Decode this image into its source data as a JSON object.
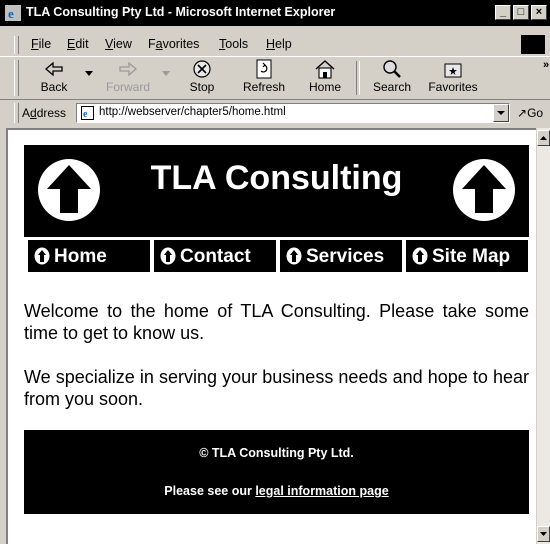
{
  "window": {
    "title": "TLA Consulting Pty Ltd - Microsoft Internet Explorer"
  },
  "menu": [
    "File",
    "Edit",
    "View",
    "Favorites",
    "Tools",
    "Help"
  ],
  "menu_mnemonics": [
    "F",
    "E",
    "V",
    "a",
    "T",
    "H"
  ],
  "toolbar": {
    "back": "Back",
    "forward": "Forward",
    "stop": "Stop",
    "refresh": "Refresh",
    "home": "Home",
    "search": "Search",
    "favorites": "Favorites"
  },
  "address": {
    "label": "Address",
    "url": "http://webserver/chapter5/home.html",
    "go": "Go"
  },
  "page": {
    "brand": "TLA Consulting",
    "nav": [
      "Home",
      "Contact",
      "Services",
      "Site Map"
    ],
    "para1": "Welcome to the home of TLA Consulting. Please take some time to get to know us.",
    "para2": "We specialize in serving your business needs and hope to hear from you soon.",
    "footer": {
      "copyright": "© TLA Consulting Pty Ltd.",
      "legal_prefix": "Please see our ",
      "legal_link": "legal information page"
    }
  },
  "colors": {
    "banner": "#000000",
    "text_on_dark": "#ffffff",
    "chrome": "#d4d0c8"
  }
}
